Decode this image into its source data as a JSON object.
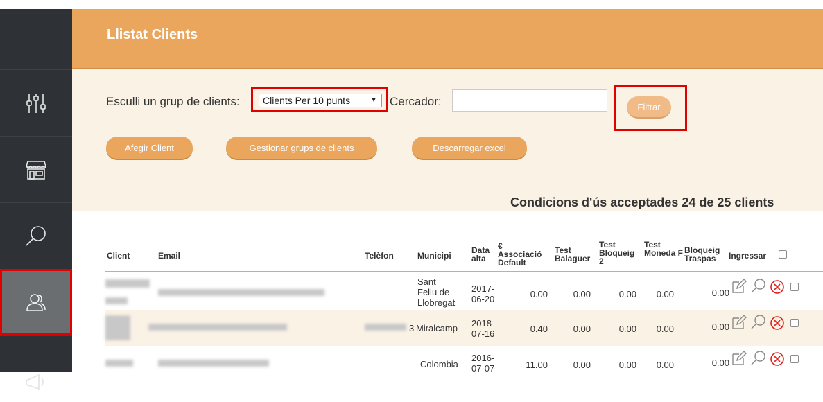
{
  "header": {
    "title": "Llistat Clients"
  },
  "filters": {
    "group_label": "Esculli un grup de clients:",
    "group_selected": "Clients Per 10 punts",
    "search_label": "Cercador:",
    "search_value": "",
    "filter_button": "Filtrar"
  },
  "actions": {
    "add_client": "Afegir Client",
    "manage_groups": "Gestionar grups de clients",
    "download_excel": "Descarregar excel"
  },
  "summary": "Condicions d'ús acceptades 24 de 25 clients",
  "table": {
    "columns": {
      "client": "Client",
      "email": "Email",
      "phone": "Telèfon",
      "municipi": "Municipi",
      "data_alta": "Data alta",
      "associacio": "€ Associació Default",
      "test_balaguer": "Test Balaguer",
      "test_bloqueig": "Test Bloqueig 2",
      "test_moneda": "Test Moneda F",
      "bloqueig_traspas": "Bloqueig Traspas",
      "ingressar": "Ingressar"
    },
    "rows": [
      {
        "phone_suffix": "",
        "municipi": "Sant Feliu de Llobregat",
        "data_alta": "2017-06-20",
        "associacio": "0.00",
        "test_balaguer": "0.00",
        "test_bloqueig": "0.00",
        "test_moneda": "0.00",
        "bloqueig_traspas": "0.00"
      },
      {
        "phone_suffix": "3",
        "municipi": "Miralcamp",
        "data_alta": "2018-07-16",
        "associacio": "0.40",
        "test_balaguer": "0.00",
        "test_bloqueig": "0.00",
        "test_moneda": "0.00",
        "bloqueig_traspas": "0.00"
      },
      {
        "phone_suffix": "",
        "municipi": "Colombia",
        "data_alta": "2016-07-07",
        "associacio": "11.00",
        "test_balaguer": "0.00",
        "test_bloqueig": "0.00",
        "test_moneda": "0.00",
        "bloqueig_traspas": "0.00"
      }
    ]
  },
  "sidebar": {
    "items": [
      {
        "icon": "sliders-icon"
      },
      {
        "icon": "store-icon"
      },
      {
        "icon": "search-icon"
      },
      {
        "icon": "users-icon",
        "active": true
      },
      {
        "icon": "megaphone-icon"
      }
    ]
  },
  "colors": {
    "accent": "#eba65e",
    "panel": "#fbf2e6",
    "sidebar": "#2e3236",
    "highlight": "#e00000"
  }
}
